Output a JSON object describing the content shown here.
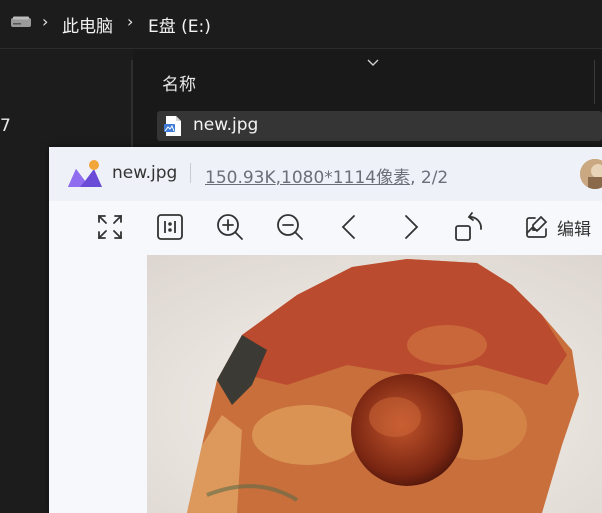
{
  "breadcrumb": {
    "items": [
      "此电脑",
      "E盘 (E:)"
    ],
    "drive_icon": "drive-icon",
    "separator_icon": "chevron-right-icon"
  },
  "nav_pane": {
    "partial_text": "7"
  },
  "file_list": {
    "column_name": "名称",
    "sort_icon": "chevron-down-icon",
    "rows": [
      {
        "name": "new.jpg",
        "icon": "image-file-icon",
        "selected": true
      }
    ]
  },
  "viewer": {
    "filename": "new.jpg",
    "file_size": "150.93K",
    "dimensions": ",1080*1114像素",
    "index": ", 2/2",
    "toolbar": {
      "fullscreen": "expand-icon",
      "actual_size": "actual-size-icon",
      "zoom_in": "zoom-in-icon",
      "zoom_out": "zoom-out-icon",
      "previous": "chevron-left-icon",
      "next": "chevron-right-icon",
      "rotate": "rotate-icon",
      "edit_label": "编辑"
    },
    "image_subject": "photo"
  },
  "colors": {
    "explorer_bg": "#1c1c1c",
    "selected_row": "#353535",
    "viewer_bg": "#f6f8fb",
    "logo_purple": "#6a4bd8",
    "logo_orange": "#f2a63a"
  }
}
